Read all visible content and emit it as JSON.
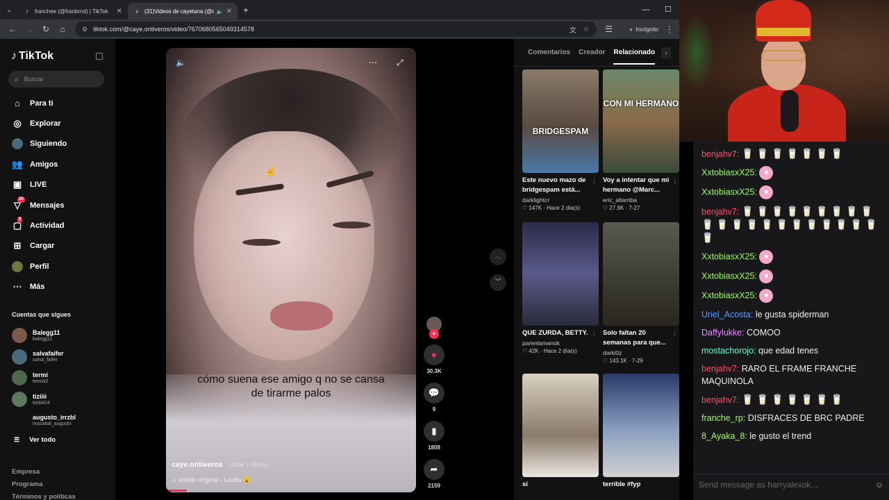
{
  "browser": {
    "tabs": [
      {
        "title": "franchee (@franbrnd) | TikTok",
        "active": false
      },
      {
        "title": "(31)Videos de cayetana (@c...",
        "active": true
      }
    ],
    "url": "tiktok.com/@caye.ontiveros/video/7670680565049314578",
    "incognito_label": "Incógnito"
  },
  "sidebar": {
    "logo": "TikTok",
    "search_placeholder": "Buscar",
    "items": [
      {
        "label": "Para ti",
        "icon": "home-icon"
      },
      {
        "label": "Explorar",
        "icon": "compass-icon"
      },
      {
        "label": "Siguiendo",
        "icon": "following-avatar-icon"
      },
      {
        "label": "Amigos",
        "icon": "friends-icon"
      },
      {
        "label": "LIVE",
        "icon": "live-icon"
      },
      {
        "label": "Mensajes",
        "icon": "messages-icon",
        "badge": "26"
      },
      {
        "label": "Actividad",
        "icon": "activity-icon",
        "badge": "5"
      },
      {
        "label": "Cargar",
        "icon": "upload-icon"
      },
      {
        "label": "Perfil",
        "icon": "profile-icon"
      },
      {
        "label": "Más",
        "icon": "more-icon"
      }
    ],
    "following_header": "Cuentas que sigues",
    "following": [
      {
        "name": "Balegg11",
        "user": "balegg11"
      },
      {
        "name": "salvafaifer",
        "user": "salva_faifer"
      },
      {
        "name": "termi",
        "user": "termiii2"
      },
      {
        "name": "tiziiii",
        "user": "tiziiii424"
      },
      {
        "name": "augusto_irrzbl",
        "user": "irrazabal_augusto"
      }
    ],
    "see_all": "Ver todo",
    "footer": [
      "Empresa",
      "Programa",
      "Términos y políticas"
    ]
  },
  "video": {
    "caption_overlay": "cómo suena ese amigo q no se cansa de tirarme palos",
    "author": "caye.ontiveros",
    "posted": "· Hace 1 día(s)",
    "sound": "sonido original - Lautta 😮",
    "likes": "30.3K",
    "comments": "9",
    "saves": "1808",
    "shares": "2159"
  },
  "right_panel": {
    "tabs": [
      "Comentarios",
      "Creador",
      "Relacionado"
    ],
    "active_tab": "Relacionado",
    "cards": [
      {
        "thumb_text": "BRIDGESPAM",
        "title": "Este nuevo mazo de bridgespam está...",
        "author": "darklightcr",
        "stats": "♡ 147K · Hace 2 día(s)"
      },
      {
        "thumb_text": "CON MI HERMANO",
        "title": "Voy a intentar que mi hermano @Marc...",
        "author": "eric_altarriba",
        "stats": "♡ 27.9K · 7-27"
      },
      {
        "thumb_text": "",
        "title": "QUE ZURDA, BETTY.",
        "author": "parenlamanok",
        "stats": "♡ 42K · Hace 2 día(s)"
      },
      {
        "thumb_text": "",
        "title": "Solo faltan 20 semanas para que...",
        "author": "darki0z",
        "stats": "♡ 143.1K · 7-29"
      },
      {
        "thumb_text": "",
        "title": "si",
        "author": "",
        "stats": ""
      },
      {
        "thumb_text": "",
        "title": "terrible #fyp",
        "author": "",
        "stats": ""
      }
    ]
  },
  "chat": {
    "messages": [
      {
        "user": "benjahv7:",
        "color": "#ff4f6d",
        "text": "",
        "emote": "cups7"
      },
      {
        "user": "XxtobiasxX25:",
        "color": "#9eff5a",
        "text": "",
        "emote": "heart"
      },
      {
        "user": "XxtobiasxX25:",
        "color": "#9eff5a",
        "text": "",
        "emote": "heart"
      },
      {
        "user": "benjahv7:",
        "color": "#ff4f6d",
        "text": "",
        "emote": "cups22"
      },
      {
        "user": "XxtobiasxX25:",
        "color": "#9eff5a",
        "text": "",
        "emote": "heart"
      },
      {
        "user": "XxtobiasxX25:",
        "color": "#9eff5a",
        "text": "",
        "emote": "heart"
      },
      {
        "user": "XxtobiasxX25:",
        "color": "#9eff5a",
        "text": "",
        "emote": "heart"
      },
      {
        "user": "Uriel_Acosta:",
        "color": "#5a9cff",
        "text": "le gusta spiderman",
        "emote": ""
      },
      {
        "user": "Daffylukke:",
        "color": "#e98bff",
        "text": "COMOO",
        "emote": ""
      },
      {
        "user": "mostachorojo:",
        "color": "#5affd0",
        "text": "que edad tenes",
        "emote": ""
      },
      {
        "user": "benjahv7:",
        "color": "#ff4f6d",
        "text": "RARO EL FRAME FRANCHE MAQUINOLA",
        "emote": ""
      },
      {
        "user": "benjahv7:",
        "color": "#ff4f6d",
        "text": "",
        "emote": "cups7"
      },
      {
        "user": "franche_rp:",
        "color": "#9eff5a",
        "text": "DISFRACES DE BRC PADRE",
        "emote": ""
      },
      {
        "user": "8_Ayaka_8:",
        "color": "#9eff5a",
        "text": "le gusto el trend",
        "emote": ""
      }
    ],
    "input_placeholder": "Send message as harryalexok..."
  }
}
